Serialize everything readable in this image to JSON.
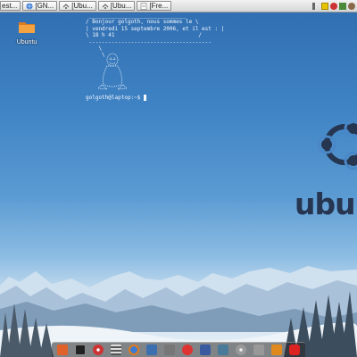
{
  "taskbar": {
    "tasks": [
      {
        "label": "est...",
        "icon": "terminal-icon"
      },
      {
        "label": "[GN...",
        "icon": "globe-icon"
      },
      {
        "label": "[Ubu...",
        "icon": "network-icon"
      },
      {
        "label": "[Ubu...",
        "icon": "network-icon"
      },
      {
        "label": "[Fre...",
        "icon": "document-icon"
      }
    ],
    "tray": [
      "speaker-icon",
      "notes-icon",
      "power-icon",
      "network-tray-icon",
      "user-icon"
    ]
  },
  "desktop": {
    "icon_label": "Ubuntu"
  },
  "terminal": {
    "cowsay": " ______________________________\n/ Bonjour golgoth, nous sommes le \\\n| vendredi 15 septembre 2006, et il est : |\n\\ 18 h 41                          /\n --------------------------------------\n    \\\n     \\",
    "prompt": "golgoth@laptop:~$ "
  },
  "branding": {
    "wordmark": "ubun",
    "color": "#263550"
  },
  "dock": {
    "icons": [
      "flame-icon",
      "terminal-icon",
      "cd-icon",
      "list-icon",
      "firefox-icon",
      "shield-icon",
      "pen-icon",
      "mail-icon",
      "ubuntu-icon",
      "network-icon",
      "dvd-icon",
      "trash-icon",
      "music-icon",
      "power-icon"
    ]
  },
  "colors": {
    "sky_top": "#2f6db0",
    "sky_bottom": "#c4dbee",
    "text": "#f4f8ff"
  }
}
